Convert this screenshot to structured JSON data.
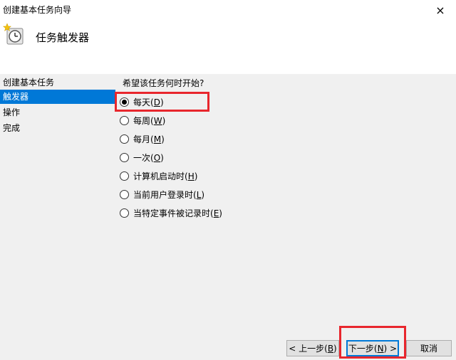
{
  "window": {
    "title": "创建基本任务向导",
    "close_glyph": "×"
  },
  "header": {
    "title": "任务触发器",
    "icon": "clock-task-icon"
  },
  "sidebar": {
    "items": [
      {
        "label": "创建基本任务",
        "active": false
      },
      {
        "label": "触发器",
        "active": true
      },
      {
        "label": "操作",
        "active": false
      },
      {
        "label": "完成",
        "active": false
      }
    ]
  },
  "content": {
    "question": "希望该任务何时开始?",
    "options": [
      {
        "label": "每天",
        "key": "D",
        "selected": true
      },
      {
        "label": "每周",
        "key": "W",
        "selected": false
      },
      {
        "label": "每月",
        "key": "M",
        "selected": false
      },
      {
        "label": "一次",
        "key": "O",
        "selected": false
      },
      {
        "label": "计算机启动时",
        "key": "H",
        "selected": false
      },
      {
        "label": "当前用户登录时",
        "key": "L",
        "selected": false
      },
      {
        "label": "当特定事件被记录时",
        "key": "E",
        "selected": false
      }
    ]
  },
  "buttons": {
    "back_prefix": "< 上一步(",
    "back_key": "B",
    "back_suffix": ")",
    "next_prefix": "下一步(",
    "next_key": "N",
    "next_suffix": ") >",
    "cancel": "取消"
  },
  "colors": {
    "selection": "#0078d7",
    "highlight": "#e8262d"
  }
}
